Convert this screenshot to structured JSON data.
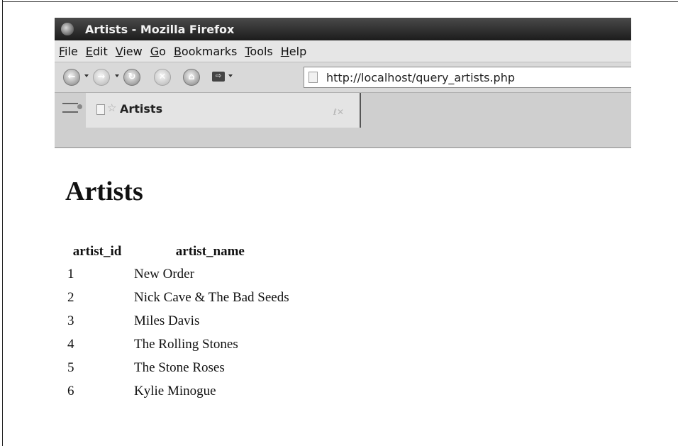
{
  "window": {
    "title": "Artists - Mozilla Firefox"
  },
  "menubar": {
    "items": [
      "File",
      "Edit",
      "View",
      "Go",
      "Bookmarks",
      "Tools",
      "Help"
    ]
  },
  "navbar": {
    "url": "http://localhost/query_artists.php",
    "icons": [
      "back-icon",
      "forward-icon",
      "reload-icon",
      "stop-icon",
      "home-icon",
      "go-icon"
    ]
  },
  "tab": {
    "title": "Artists"
  },
  "page": {
    "heading": "Artists",
    "columns": [
      "artist_id",
      "artist_name"
    ],
    "rows": [
      [
        "1",
        "New Order"
      ],
      [
        "2",
        "Nick Cave & The Bad Seeds"
      ],
      [
        "3",
        "Miles Davis"
      ],
      [
        "4",
        "The Rolling Stones"
      ],
      [
        "5",
        "The Stone Roses"
      ],
      [
        "6",
        "Kylie Minogue"
      ]
    ]
  }
}
